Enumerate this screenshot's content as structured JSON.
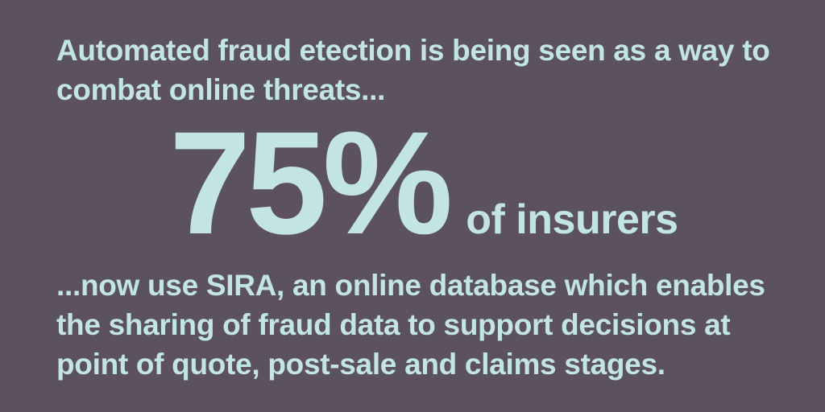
{
  "intro": {
    "text": "Automated fraud etection is being seen as a way to combat online threats..."
  },
  "stat": {
    "number": "75%",
    "label": "of insurers"
  },
  "outro": {
    "text": "...now use SIRA, an online database which enables the sharing of fraud data to support decisions at point of quote, post-sale and claims stages."
  },
  "colors": {
    "background": "#5b515f",
    "text": "#c2e4e4"
  }
}
